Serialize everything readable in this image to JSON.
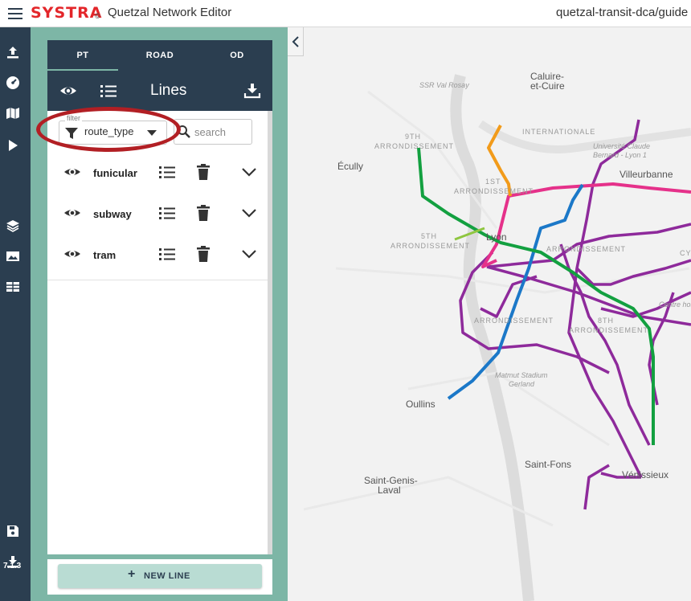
{
  "topbar": {
    "brand": "SYSTRA",
    "brand_mark": "©",
    "app_title": "Quetzal Network Editor",
    "project": "quetzal-transit-dca/guide"
  },
  "rail": {
    "icons": [
      "upload-icon",
      "dashboard-icon",
      "map-icon",
      "play-icon",
      "layers-icon",
      "image-icon",
      "table-icon",
      "save-icon",
      "download-icon"
    ],
    "version": "7.1.3"
  },
  "panel": {
    "tabs": [
      {
        "label": "PT",
        "active": true
      },
      {
        "label": "ROAD",
        "active": false
      },
      {
        "label": "OD",
        "active": false
      }
    ],
    "title": "Lines",
    "filter": {
      "legend": "filter",
      "value": "route_type"
    },
    "search": {
      "placeholder": "search"
    },
    "groups": [
      {
        "label": "funicular"
      },
      {
        "label": "subway"
      },
      {
        "label": "tram"
      }
    ],
    "new_line_label": "NEW LINE"
  },
  "map": {
    "labels": {
      "caluire": "Caluire-",
      "caluire2": "et-Cuire",
      "ssr": "SSR Val Rosay",
      "ecully": "Écully",
      "villeurbanne": "Villeurbanne",
      "international": "INTERNATIONALE",
      "univ": "Université Claude",
      "univ2": "Bernard - Lyon 1",
      "arr9": "9TH",
      "arr9b": "ARRONDISSEMENT",
      "arr1": "1ST",
      "arr1b": "ARRONDISSEMENT",
      "arr5": "5TH",
      "arr5b": "ARRONDISSEMENT",
      "lyon": "Lyon",
      "arr3": "ARRONDISSEMENT",
      "arr7": "ARRONDISSEMENT",
      "arr8": "8TH",
      "arr8b": "ARRONDISSEMENT",
      "cy": "CY",
      "stadium": "Matmut Stadium",
      "stadium2": "Gerland",
      "oullins": "Oullins",
      "stfons": "Saint-Fons",
      "stgenis": "Saint-Genis-",
      "stgenis2": "Laval",
      "venissieux": "Vénissieux",
      "bron": "Centre hos"
    },
    "route_colors": {
      "tram": "#8e2a9b",
      "metro_a": "#e5318a",
      "metro_b": "#1b78c8",
      "metro_d": "#13a040",
      "funicular": "#f29b1a",
      "funicular2": "#8fc640"
    }
  }
}
